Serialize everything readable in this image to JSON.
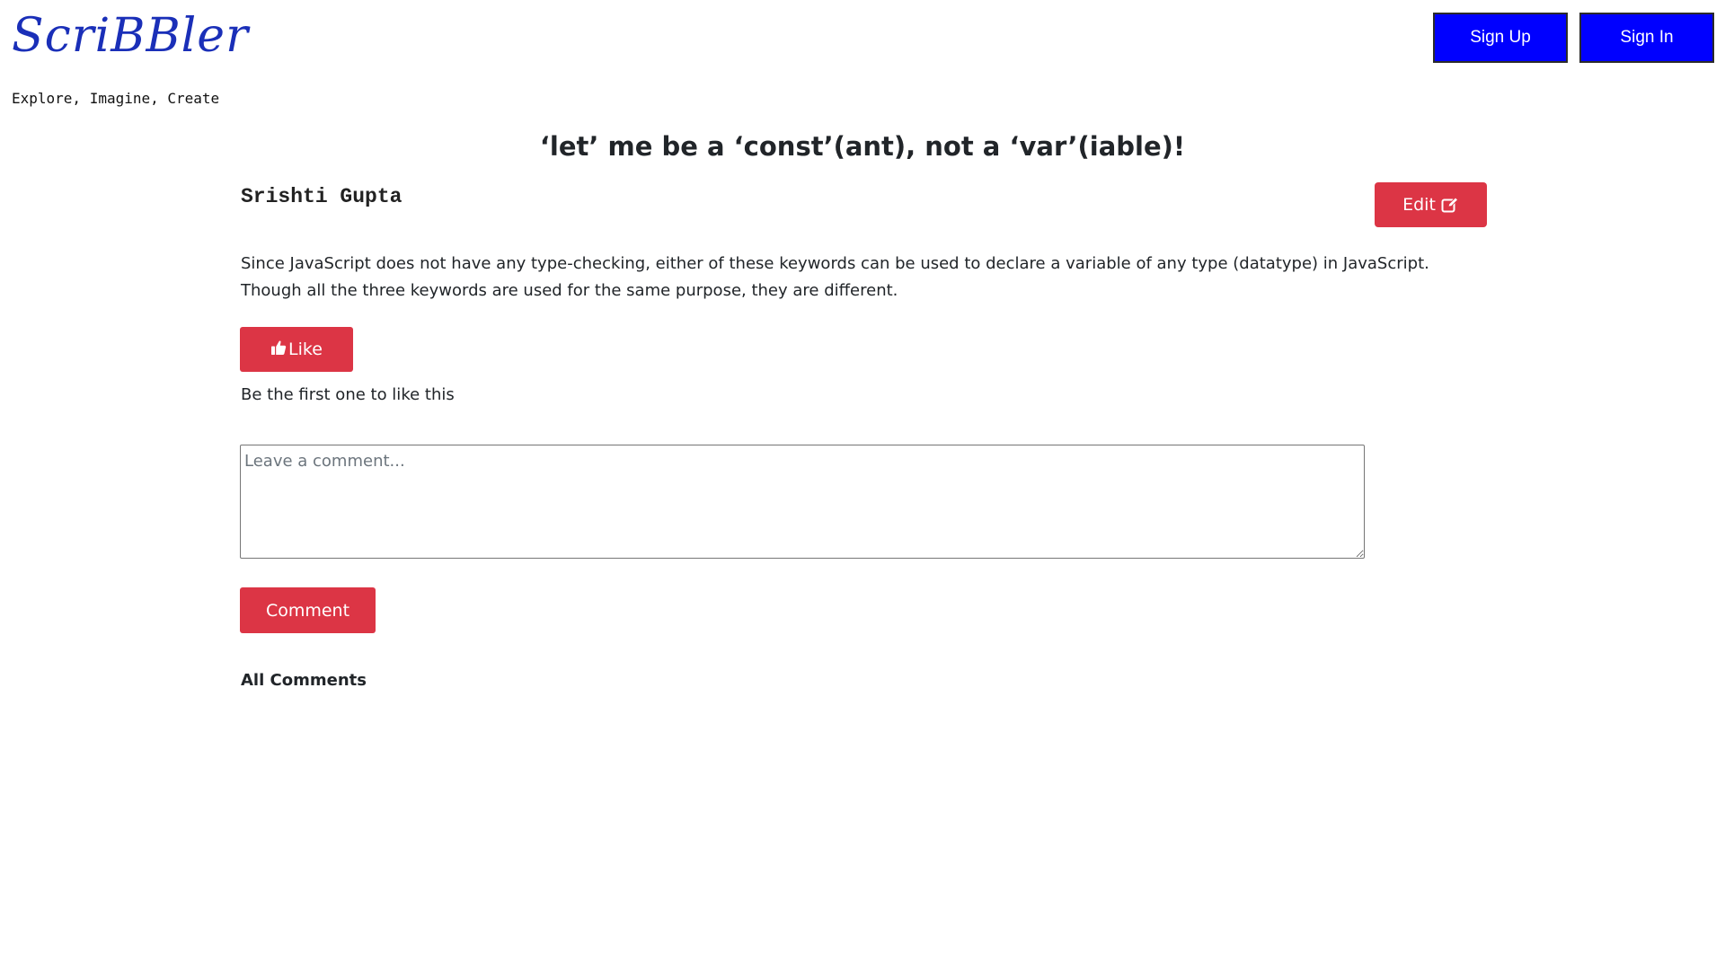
{
  "header": {
    "logo_text": "ScriBBler",
    "tagline": "Explore, Imagine, Create",
    "signup_label": "Sign Up",
    "signin_label": "Sign In",
    "auth_button_color": "#0000ff",
    "logo_color": "#1a2fb8"
  },
  "post": {
    "title": "‘let’ me be a ‘const’(ant), not a ‘var’(iable)!",
    "author": "Srishti Gupta",
    "edit_label": "Edit",
    "edit_icon": "edit-icon",
    "body": "Since JavaScript does not have any type-checking, either of these keywords can be used to declare a variable of any type (datatype) in JavaScript. Though all the three keywords are used for the same purpose, they are different.",
    "like_label": "Like",
    "like_icon": "thumbs-up-icon",
    "like_status": "Be the first one to like this",
    "action_button_color": "#dc3545"
  },
  "comments": {
    "placeholder": "Leave a comment...",
    "value": "",
    "submit_label": "Comment",
    "heading": "All Comments"
  }
}
